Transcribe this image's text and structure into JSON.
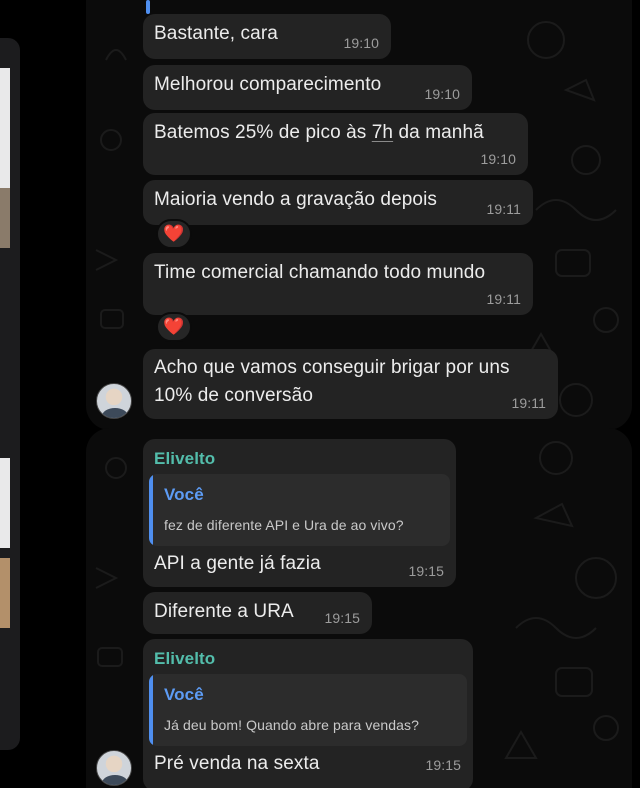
{
  "chat": {
    "messages": [
      {
        "text": "Bastante, cara",
        "time": "19:10"
      },
      {
        "text": "Melhorou comparecimento",
        "time": "19:10"
      },
      {
        "text_before": "Batemos 25% de pico às ",
        "text_underlined": "7h",
        "text_after": " da manhã",
        "time": "19:10"
      },
      {
        "text": "Maioria vendo a gravação depois",
        "time": "19:11",
        "reaction": "❤️"
      },
      {
        "text": "Time comercial chamando todo mundo",
        "time": "19:11",
        "reaction": "❤️"
      },
      {
        "line1": "Acho que vamos conseguir brigar por uns",
        "line2": "10% de conversão",
        "time": "19:11"
      },
      {
        "sender": "Elivelto",
        "quote_name": "Você",
        "quote_text": "fez de diferente API e Ura de ao vivo?",
        "text": "API a gente já fazia",
        "time": "19:15"
      },
      {
        "text": "Diferente a URA",
        "time": "19:15"
      },
      {
        "sender": "Elivelto",
        "quote_name": "Você",
        "quote_text": "Já deu bom! Quando abre para vendas?",
        "text": "Pré venda na sexta",
        "time": "19:15"
      }
    ]
  },
  "icons": {
    "reaction": "heart-icon",
    "avatar": "contact-avatar"
  },
  "colors": {
    "background": "#000000",
    "chat_background": "#0b0b0b",
    "bubble": "#232323",
    "sender_name": "#53bdab",
    "quote_name": "#5d9cf5",
    "timestamp": "#9c9c9c",
    "heart": "#e53935"
  }
}
